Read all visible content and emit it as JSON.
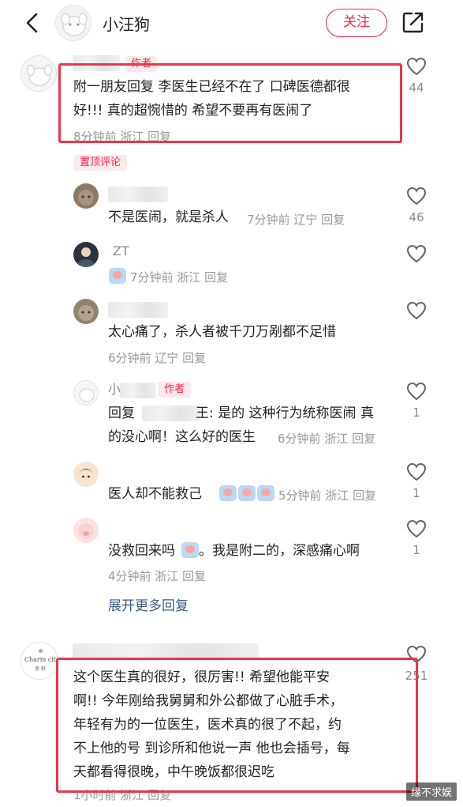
{
  "header": {
    "title": "小汪狗",
    "follow_label": "关注"
  },
  "main_comment": {
    "author_tag": "作者",
    "text_line1": "附一朋友回复 李医生已经不在了 口碑医德都很",
    "text_line2": "好!!! 真的超惋惜的 希望不要再有医闹了",
    "meta": "8分钟前  浙江  回复",
    "likes": "44"
  },
  "pinned_tag": "置顶评论",
  "replies": [
    {
      "name": "",
      "text": "不是医闹，就是杀人",
      "meta": "7分钟前  辽宁  回复",
      "likes": "46"
    },
    {
      "name": "ZT",
      "text": "",
      "meta": "7分钟前  浙江  回复",
      "likes": ""
    },
    {
      "name": "",
      "text": "太心痛了，杀人者被千刀万剐都不足惜",
      "meta": "6分钟前  辽宁  回复",
      "likes": ""
    },
    {
      "name": "小",
      "author_tag": "作者",
      "text_pre": "回复",
      "text_mid": "王: 是的 这种行为统称医闹 真",
      "text_line2": "的没心啊！这么好的医生",
      "meta": "6分钟前  浙江  回复",
      "likes": "1"
    },
    {
      "name": "",
      "text": "医人却不能救己",
      "meta": "5分钟前  浙江  回复",
      "likes": "1"
    },
    {
      "name": "",
      "text_a": "没救回来吗",
      "text_b": "。我是附二的，深感痛心啊",
      "meta": "4分钟前  浙江  回复",
      "likes": "1"
    }
  ],
  "show_more": "展开更多回复",
  "comment2": {
    "avatar_text": "Charm cit",
    "avatar_sub": "瘦·野",
    "likes": "251",
    "lines": [
      "这个医生真的很好，很厉害!! 希望他能平安",
      "啊!! 今年刚给我舅舅和外公都做了心脏手术，",
      "年轻有为的一位医生，医术真的很了不起，约",
      "不上他的号 到诊所和他说一声 他也会插号，每",
      "天都看得很晚，中午晚饭都很迟吃"
    ],
    "meta": "1小时前  浙江  回复"
  },
  "watermark": "缘不求娱"
}
